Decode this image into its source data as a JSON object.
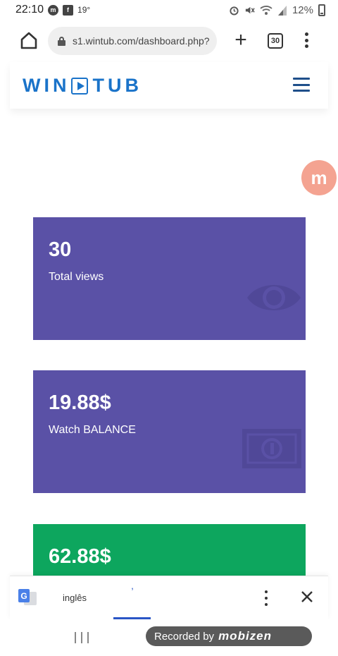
{
  "status_bar": {
    "time": "22:10",
    "temperature": "19°",
    "battery": "12%",
    "icons": [
      "mobizen-icon",
      "facebook-icon",
      "alarm-icon",
      "mute-icon",
      "wifi-icon",
      "signal-icon",
      "battery-icon"
    ]
  },
  "browser": {
    "url": "s1.wintub.com/dashboard.php?",
    "tab_count": "30"
  },
  "site": {
    "logo_left": "WIN",
    "logo_right": "TUB"
  },
  "floating_bubble": {
    "letter": "m"
  },
  "cards": [
    {
      "value": "30",
      "label": "Total views",
      "color": "#5a51a6",
      "icon": "eye-icon"
    },
    {
      "value": "19.88$",
      "label": "Watch BALANCE",
      "color": "#5a51a6",
      "icon": "money-icon"
    },
    {
      "value": "62.88$",
      "label": "",
      "color": "#0da65e"
    }
  ],
  "translate_bar": {
    "source_lang": "inglês",
    "target_lang_glyph": "ʼ"
  },
  "recording": {
    "prefix": "Recorded by",
    "brand": "mobizen"
  }
}
